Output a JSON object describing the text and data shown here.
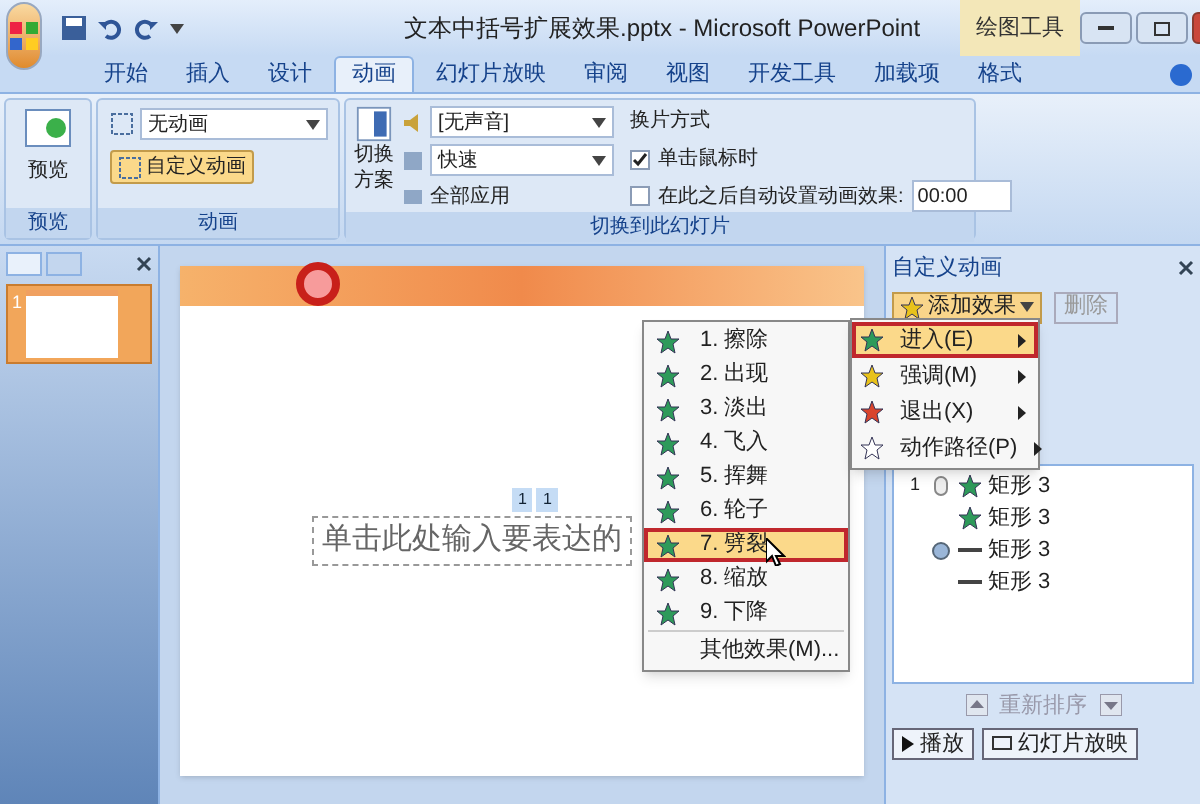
{
  "window": {
    "title": "文本中括号扩展效果.pptx - Microsoft PowerPoint",
    "context_tab": "绘图工具"
  },
  "tabs": [
    {
      "label": "开始",
      "selected": false
    },
    {
      "label": "插入",
      "selected": false
    },
    {
      "label": "设计",
      "selected": false
    },
    {
      "label": "动画",
      "selected": true
    },
    {
      "label": "幻灯片放映",
      "selected": false
    },
    {
      "label": "审阅",
      "selected": false
    },
    {
      "label": "视图",
      "selected": false
    },
    {
      "label": "开发工具",
      "selected": false
    },
    {
      "label": "加载项",
      "selected": false
    },
    {
      "label": "格式",
      "selected": false
    }
  ],
  "ribbon": {
    "preview": {
      "button": "预览",
      "group": "预览"
    },
    "animation": {
      "dropdown": "无动画",
      "custom_button": "自定义动画",
      "custom_on": true,
      "group": "动画"
    },
    "transition": {
      "scheme_button": [
        "切换",
        "方案"
      ],
      "sound": "[无声音]",
      "speed": "快速",
      "apply_all": "全部应用",
      "advance_title": "换片方式",
      "on_click": {
        "label": "单击鼠标时",
        "checked": true
      },
      "auto": {
        "label": "在此之后自动设置动画效果:",
        "checked": false
      },
      "time": "00:00",
      "group": "切换到此幻灯片"
    }
  },
  "slides_panel": {
    "thumbnails": [
      {
        "number": "1",
        "selected": true
      }
    ]
  },
  "slide": {
    "text": "单击此处输入要表达的",
    "tags": [
      "1",
      "1"
    ]
  },
  "effect_menu": {
    "items": [
      {
        "label": "1. 擦除",
        "selected": false
      },
      {
        "label": "2. 出现",
        "selected": false
      },
      {
        "label": "3. 淡出",
        "selected": false
      },
      {
        "label": "4. 飞入",
        "selected": false
      },
      {
        "label": "5. 挥舞",
        "selected": false
      },
      {
        "label": "6. 轮子",
        "selected": false
      },
      {
        "label": "7. 劈裂",
        "selected": true
      },
      {
        "label": "8. 缩放",
        "selected": false
      },
      {
        "label": "9. 下降",
        "selected": false
      }
    ],
    "more": "其他效果(M)..."
  },
  "add_menu": {
    "items": [
      {
        "label": "进入(E)",
        "selected": true,
        "color": "#2e9a5a"
      },
      {
        "label": "强调(M)",
        "selected": false,
        "color": "#e8c21a"
      },
      {
        "label": "退出(X)",
        "selected": false,
        "color": "#d9442c"
      },
      {
        "label": "动作路径(P)",
        "selected": false,
        "color": "#ffffff"
      }
    ]
  },
  "task_pane": {
    "title": "自定义动画",
    "add_effect": "添加效果",
    "remove": "删除",
    "remove_disabled": true,
    "list": [
      {
        "order": "1",
        "on_click": true,
        "after_previous": false,
        "kind": "star",
        "name": "矩形 3"
      },
      {
        "on_click": false,
        "after_previous": false,
        "kind": "star",
        "name": "矩形 3"
      },
      {
        "on_click": false,
        "after_previous": true,
        "kind": "line",
        "name": "矩形 3"
      },
      {
        "on_click": false,
        "after_previous": false,
        "kind": "line",
        "name": "矩形 3"
      }
    ],
    "reorder": "重新排序",
    "play": "播放",
    "slideshow": "幻灯片放映"
  }
}
